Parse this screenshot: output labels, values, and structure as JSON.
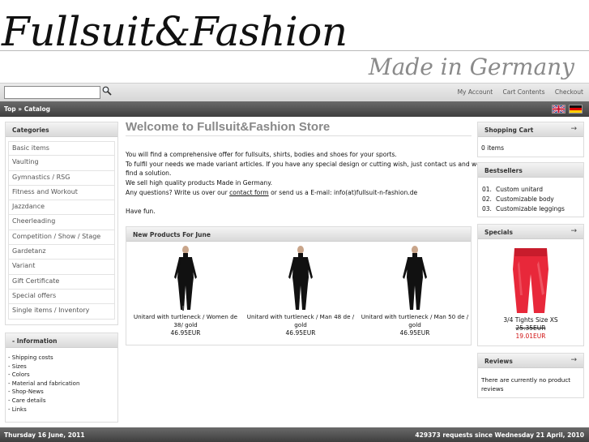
{
  "header": {
    "logo_text": "Fullsuit&Fashion",
    "tagline": "Made in Germany"
  },
  "search": {
    "value": "",
    "placeholder": ""
  },
  "top_links": {
    "my_account": "My Account",
    "cart_contents": "Cart Contents",
    "checkout": "Checkout"
  },
  "breadcrumb": {
    "text": "Top » Catalog"
  },
  "categories": {
    "title": "Categories",
    "items": [
      "Basic items",
      "Vaulting",
      "Gymnastics / RSG",
      "Fitness and Workout",
      "Jazzdance",
      "Cheerleading",
      "Competition / Show / Stage",
      "Gardetanz",
      "Variant",
      "Gift Certificate",
      "Special offers",
      "Single items / Inventory"
    ]
  },
  "information": {
    "title": "- Information",
    "items": [
      "- Shipping costs",
      "- Sizes",
      "- Colors",
      "- Material and fabrication",
      "- Shop-News",
      "- Care details",
      "- Links"
    ]
  },
  "welcome": {
    "title": "Welcome to Fullsuit&Fashion Store",
    "line1": "You will find a comprehensive offer for fullsuits, shirts, bodies and shoes for your sports.",
    "line2": "To fulfil your needs we made variant articles. If you have any special design or cutting wish, just contact us and we",
    "line3": "find a solution.",
    "line4": "We sell high quality products Made in Germany.",
    "line5_prefix": "Any questions? Write us over our ",
    "line5_link": "contact form",
    "line5_suffix": " or send us a E-mail: info(at)fullsuit-n-fashion.de",
    "line6": "Have fun."
  },
  "new_products": {
    "title": "New Products For June",
    "items": [
      {
        "name": "Unitard with turtleneck / Women de 38/ gold",
        "price": "46.95EUR"
      },
      {
        "name": "Unitard with turtleneck / Man 48 de / gold",
        "price": "46.95EUR"
      },
      {
        "name": "Unitard with turtleneck / Man 50 de / gold",
        "price": "46.95EUR"
      }
    ]
  },
  "shopping_cart": {
    "title": "Shopping Cart",
    "text": "0 items",
    "arrow": "→"
  },
  "bestsellers": {
    "title": "Bestsellers",
    "items": [
      {
        "num": "01.",
        "name": "Custom unitard"
      },
      {
        "num": "02.",
        "name": "Customizable body"
      },
      {
        "num": "03.",
        "name": "Customizable leggings"
      }
    ]
  },
  "specials": {
    "title": "Specials",
    "arrow": "→",
    "name": "3/4 Tights Size XS",
    "old_price": "25.35EUR",
    "new_price": "19.01EUR"
  },
  "reviews": {
    "title": "Reviews",
    "arrow": "→",
    "text_line1": "There are currently no product",
    "text_line2": "reviews"
  },
  "footer": {
    "date": "Thursday 16 June, 2011",
    "requests": "429373 requests since Wednesday 21 April, 2010"
  },
  "colors": {
    "special_price": "#d01010",
    "bar_dark": "#4a4a4a",
    "tights_red": "#e8283a"
  }
}
